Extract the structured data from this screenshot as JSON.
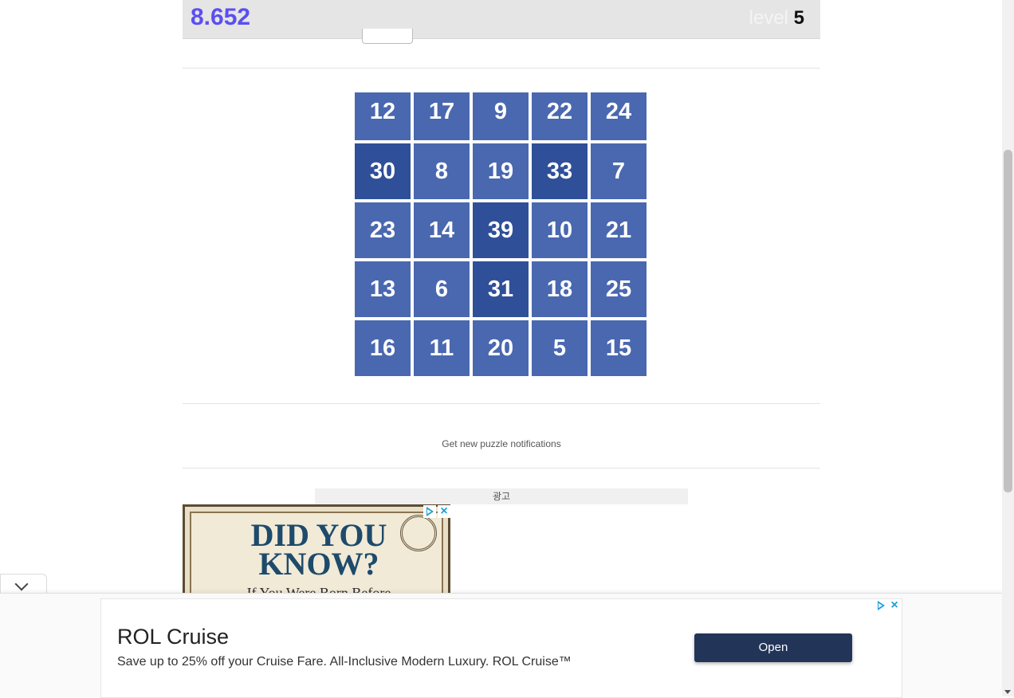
{
  "header": {
    "timer": "8.652",
    "level_label": "level",
    "level_value": "5"
  },
  "grid": {
    "cells": [
      {
        "value": "12",
        "dark": false
      },
      {
        "value": "17",
        "dark": false
      },
      {
        "value": "9",
        "dark": false
      },
      {
        "value": "22",
        "dark": false
      },
      {
        "value": "24",
        "dark": false
      },
      {
        "value": "30",
        "dark": true
      },
      {
        "value": "8",
        "dark": false
      },
      {
        "value": "19",
        "dark": false
      },
      {
        "value": "33",
        "dark": true
      },
      {
        "value": "7",
        "dark": false
      },
      {
        "value": "23",
        "dark": false
      },
      {
        "value": "14",
        "dark": false
      },
      {
        "value": "39",
        "dark": true
      },
      {
        "value": "10",
        "dark": false
      },
      {
        "value": "21",
        "dark": false
      },
      {
        "value": "13",
        "dark": false
      },
      {
        "value": "6",
        "dark": false
      },
      {
        "value": "31",
        "dark": true
      },
      {
        "value": "18",
        "dark": false
      },
      {
        "value": "25",
        "dark": false
      },
      {
        "value": "16",
        "dark": false
      },
      {
        "value": "11",
        "dark": false
      },
      {
        "value": "20",
        "dark": false
      },
      {
        "value": "5",
        "dark": false
      },
      {
        "value": "15",
        "dark": false
      }
    ]
  },
  "notifications": {
    "label": "Get new puzzle notifications"
  },
  "ad": {
    "label": "광고",
    "image_line1": "DID YOU",
    "image_line2": "KNOW?",
    "image_line3": "If You Were Born Before"
  },
  "sticky_ad": {
    "title": "ROL Cruise",
    "description": "Save up to 25% off your Cruise Fare. All-Inclusive Modern Luxury. ROL Cruise™",
    "button_label": "Open"
  },
  "colors": {
    "accent": "#5b4ff0",
    "cell": "#4a68b0",
    "cell_dark": "#2f4f98",
    "button": "#223559",
    "adchoices": "#1aa0d8"
  }
}
